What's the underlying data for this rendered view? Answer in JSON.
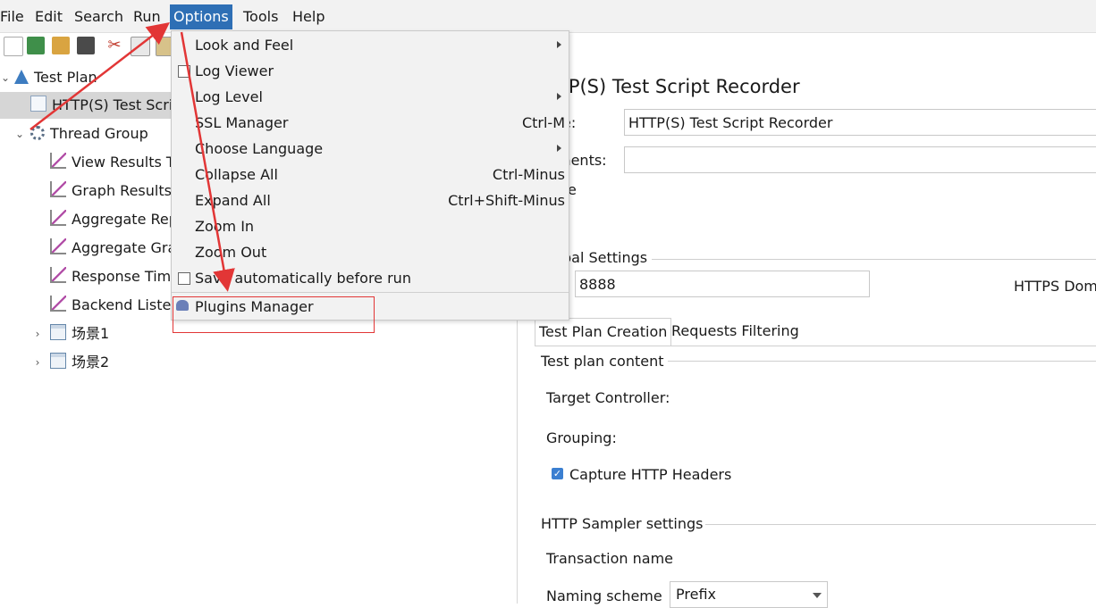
{
  "menubar": {
    "items": [
      {
        "label": "File",
        "mnemonic": "F"
      },
      {
        "label": "Edit",
        "mnemonic": "E"
      },
      {
        "label": "Search",
        "mnemonic": "S"
      },
      {
        "label": "Run",
        "mnemonic": "R"
      },
      {
        "label": "Options",
        "mnemonic": "O",
        "active": true
      },
      {
        "label": "Tools",
        "mnemonic": "T"
      },
      {
        "label": "Help",
        "mnemonic": "H"
      }
    ]
  },
  "toolbar": {
    "icons": [
      "new-icon",
      "templates-icon",
      "open-icon",
      "save-icon",
      "cut-icon",
      "copy-icon",
      "paste-icon"
    ]
  },
  "tree": {
    "items": [
      {
        "label": "Test Plan",
        "icon": "test-plan-icon"
      },
      {
        "label": "HTTP(S) Test Scrip",
        "icon": "recorder-icon",
        "selected": true
      },
      {
        "label": "Thread Group",
        "icon": "thread-group-icon"
      },
      {
        "label": "View Results Tr",
        "icon": "listener-icon"
      },
      {
        "label": "Graph Results",
        "icon": "listener-icon"
      },
      {
        "label": "Aggregate Rep",
        "icon": "listener-icon"
      },
      {
        "label": "Aggregate Gra",
        "icon": "listener-icon"
      },
      {
        "label": "Response Time",
        "icon": "listener-icon"
      },
      {
        "label": "Backend Listen",
        "icon": "listener-icon"
      },
      {
        "label": "场景1",
        "icon": "controller-icon"
      },
      {
        "label": "场景2",
        "icon": "controller-icon"
      }
    ]
  },
  "options_menu": {
    "items": [
      {
        "label": "Look and Feel",
        "accel": "",
        "submenu": true
      },
      {
        "label": "Log Viewer",
        "accel": "",
        "checkbox": true
      },
      {
        "label": "Log Level",
        "accel": "",
        "submenu": true
      },
      {
        "label": "SSL Manager",
        "accel": "Ctrl-M"
      },
      {
        "label": "Choose Language",
        "accel": "",
        "submenu": true
      },
      {
        "label": "Collapse All",
        "accel": "Ctrl-Minus"
      },
      {
        "label": "Expand All",
        "accel": "Ctrl+Shift-Minus"
      },
      {
        "label": "Zoom In",
        "accel": ""
      },
      {
        "label": "Zoom Out",
        "accel": ""
      },
      {
        "label": "Save automatically before run",
        "accel": "",
        "checkbox": true
      },
      {
        "label": "Plugins Manager",
        "accel": "",
        "icon": "plugin-icon"
      }
    ]
  },
  "panel": {
    "title": "TP(S) Test Script Recorder",
    "name_label": "e:",
    "name_value": "HTTP(S) Test Script Recorder",
    "comments_label": "ments:",
    "section_fragment": "e",
    "global_settings": "bal Settings",
    "port_label": ":",
    "port_value": "8888",
    "https_domains": "HTTPS Dom",
    "tabs": [
      "Test Plan Creation",
      "Requests Filtering"
    ],
    "test_plan_content": "Test plan content",
    "target_controller": "Target Controller:",
    "grouping": "Grouping:",
    "capture_headers": "Capture HTTP Headers",
    "sampler_settings": "HTTP Sampler settings",
    "transaction_name": "Transaction name",
    "naming_scheme": "Naming scheme",
    "naming_scheme_value": "Prefix"
  },
  "colors": {
    "accent": "#2e6fb5",
    "annotation": "#e23636",
    "checkbox": "#3b7fd1"
  }
}
